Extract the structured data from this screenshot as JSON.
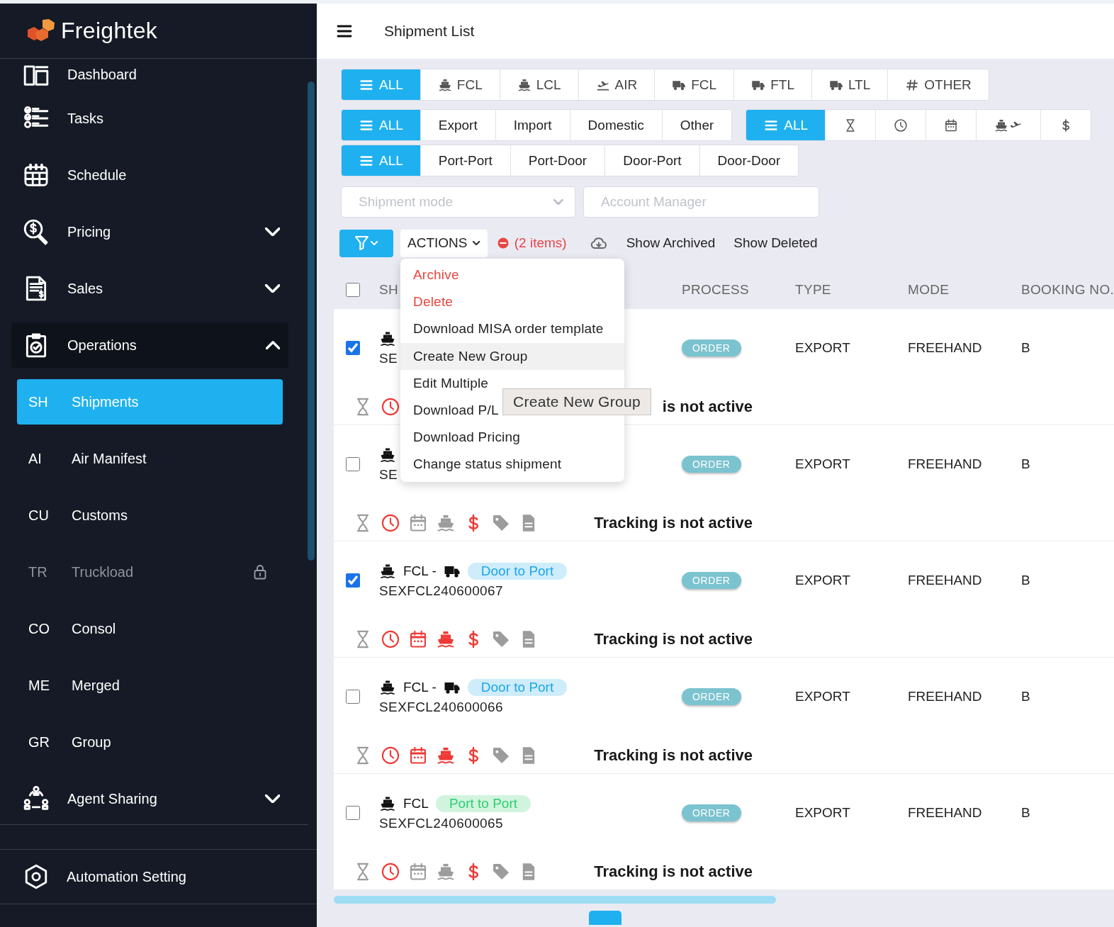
{
  "brand": {
    "name": "Freightek"
  },
  "sidebar": {
    "items": [
      {
        "kind": "main",
        "label": "Dashboard"
      },
      {
        "kind": "main",
        "label": "Tasks"
      },
      {
        "kind": "main",
        "label": "Schedule"
      },
      {
        "kind": "group",
        "label": "Pricing",
        "expanded": false
      },
      {
        "kind": "group",
        "label": "Sales",
        "expanded": false
      },
      {
        "kind": "group",
        "label": "Operations",
        "expanded": true
      },
      {
        "kind": "sub",
        "abbr": "SH",
        "label": "Shipments",
        "selected": true,
        "disabled": false
      },
      {
        "kind": "sub",
        "abbr": "AI",
        "label": "Air Manifest",
        "selected": false,
        "disabled": false
      },
      {
        "kind": "sub",
        "abbr": "CU",
        "label": "Customs",
        "selected": false,
        "disabled": false
      },
      {
        "kind": "sub",
        "abbr": "TR",
        "label": "Truckload",
        "selected": false,
        "disabled": true
      },
      {
        "kind": "sub",
        "abbr": "CO",
        "label": "Consol",
        "selected": false,
        "disabled": false
      },
      {
        "kind": "sub",
        "abbr": "ME",
        "label": "Merged",
        "selected": false,
        "disabled": false
      },
      {
        "kind": "sub",
        "abbr": "GR",
        "label": "Group",
        "selected": false,
        "disabled": false
      },
      {
        "kind": "group",
        "label": "Agent Sharing",
        "expanded": false
      }
    ],
    "footer_items": [
      {
        "label": "Automation Setting"
      }
    ]
  },
  "header": {
    "title": "Shipment List"
  },
  "filter_rows": [
    {
      "groups": [
        {
          "items": [
            {
              "kind": "list",
              "label": "ALL",
              "selected": true
            },
            {
              "kind": "ship",
              "label": "FCL",
              "selected": false
            },
            {
              "kind": "ship",
              "label": "LCL",
              "selected": false
            },
            {
              "kind": "plane",
              "label": "AIR",
              "selected": false
            },
            {
              "kind": "truck",
              "label": "FCL",
              "selected": false
            },
            {
              "kind": "truck",
              "label": "FTL",
              "selected": false
            },
            {
              "kind": "truck",
              "label": "LTL",
              "selected": false
            },
            {
              "kind": "hash",
              "label": "OTHER",
              "selected": false
            }
          ]
        }
      ]
    },
    {
      "groups": [
        {
          "items": [
            {
              "kind": "list",
              "label": "ALL",
              "selected": true
            },
            {
              "kind": "text",
              "label": "Export",
              "selected": false
            },
            {
              "kind": "text",
              "label": "Import",
              "selected": false
            },
            {
              "kind": "text",
              "label": "Domestic",
              "selected": false
            },
            {
              "kind": "text",
              "label": "Other",
              "selected": false
            }
          ]
        },
        {
          "items": [
            {
              "kind": "list",
              "label": "ALL",
              "selected": true
            },
            {
              "kind": "hourglass",
              "selected": false
            },
            {
              "kind": "clock",
              "selected": false
            },
            {
              "kind": "calendar",
              "selected": false
            },
            {
              "kind": "shipplane",
              "selected": false
            },
            {
              "kind": "dollar",
              "selected": false
            }
          ]
        }
      ]
    },
    {
      "groups": [
        {
          "items": [
            {
              "kind": "list",
              "label": "ALL",
              "selected": true
            },
            {
              "kind": "text",
              "label": "Port-Port",
              "selected": false
            },
            {
              "kind": "text",
              "label": "Port-Door",
              "selected": false
            },
            {
              "kind": "text",
              "label": "Door-Port",
              "selected": false
            },
            {
              "kind": "text",
              "label": "Door-Door",
              "selected": false
            }
          ]
        }
      ]
    }
  ],
  "fields": [
    {
      "kind": "select",
      "placeholder": "Shipment mode"
    },
    {
      "kind": "text",
      "placeholder": "Account Manager"
    }
  ],
  "toolbar": {
    "actions": {
      "label": "ACTIONS",
      "expanded": true
    },
    "selection": "(2 items)",
    "links": [
      "Show Archived",
      "Show Deleted"
    ]
  },
  "menu": {
    "items": [
      {
        "label": "Archive",
        "kind": "danger",
        "hovered": false
      },
      {
        "label": "Delete",
        "kind": "danger",
        "hovered": false
      },
      {
        "label": "Download MISA order template",
        "kind": "normal",
        "hovered": false
      },
      {
        "label": "Create New Group",
        "kind": "normal",
        "hovered": true
      },
      {
        "label": "Edit Multiple",
        "kind": "normal",
        "hovered": false
      },
      {
        "label": "Download P/L",
        "kind": "normal",
        "hovered": false
      },
      {
        "label": "Download Pricing",
        "kind": "normal",
        "hovered": false
      },
      {
        "label": "Change status shipment",
        "kind": "normal",
        "hovered": false
      }
    ],
    "tooltip": "Create New Group"
  },
  "table": {
    "all_checked": false,
    "columns": [
      "SH",
      "PROCESS",
      "TYPE",
      "MODE",
      "BOOKING NO."
    ],
    "rows": [
      {
        "checked": true,
        "code": "SE",
        "process": "ORDER",
        "type": "EXPORT",
        "mode": "FREEHAND",
        "booking": "B",
        "tracking": "is not active",
        "status_icons": [
          {
            "kind": "hourglass",
            "alert": false
          },
          {
            "kind": "clock",
            "alert": true
          }
        ]
      },
      {
        "checked": false,
        "code": "SE",
        "process": "ORDER",
        "type": "EXPORT",
        "mode": "FREEHAND",
        "booking": "B",
        "tracking": "Tracking is not active",
        "status_icons": [
          {
            "kind": "hourglass",
            "alert": false
          },
          {
            "kind": "clock",
            "alert": true
          },
          {
            "kind": "calendar",
            "alert": false
          },
          {
            "kind": "ship",
            "alert": false
          },
          {
            "kind": "dollar",
            "alert": true
          },
          {
            "kind": "tag",
            "alert": false
          },
          {
            "kind": "doc",
            "alert": false
          }
        ]
      },
      {
        "checked": true,
        "route": {
          "text": "FCL -",
          "truck": true
        },
        "service": {
          "label": "Door to Port",
          "color": "#1ea7e8"
        },
        "code": "SEXFCL240600067",
        "process": "ORDER",
        "type": "EXPORT",
        "mode": "FREEHAND",
        "booking": "B",
        "tracking": "Tracking is not active",
        "status_icons": [
          {
            "kind": "hourglass",
            "alert": false
          },
          {
            "kind": "clock",
            "alert": true
          },
          {
            "kind": "calendar",
            "alert": true
          },
          {
            "kind": "ship",
            "alert": true
          },
          {
            "kind": "dollar",
            "alert": true
          },
          {
            "kind": "tag",
            "alert": false
          },
          {
            "kind": "doc",
            "alert": false
          }
        ]
      },
      {
        "checked": false,
        "route": {
          "text": "FCL -",
          "truck": true
        },
        "service": {
          "label": "Door to Port",
          "color": "#1ea7e8"
        },
        "code": "SEXFCL240600066",
        "process": "ORDER",
        "type": "EXPORT",
        "mode": "FREEHAND",
        "booking": "B",
        "tracking": "Tracking is not active",
        "status_icons": [
          {
            "kind": "hourglass",
            "alert": false
          },
          {
            "kind": "clock",
            "alert": true
          },
          {
            "kind": "calendar",
            "alert": true
          },
          {
            "kind": "ship",
            "alert": true
          },
          {
            "kind": "dollar",
            "alert": true
          },
          {
            "kind": "tag",
            "alert": false
          },
          {
            "kind": "doc",
            "alert": false
          }
        ]
      },
      {
        "checked": false,
        "route": {
          "text": "FCL",
          "truck": false
        },
        "service": {
          "label": "Port to Port",
          "color": "#2fcf6f"
        },
        "code": "SEXFCL240600065",
        "process": "ORDER",
        "type": "EXPORT",
        "mode": "FREEHAND",
        "booking": "B",
        "tracking": "Tracking is not active",
        "status_icons": [
          {
            "kind": "hourglass",
            "alert": false
          },
          {
            "kind": "clock",
            "alert": true
          },
          {
            "kind": "calendar",
            "alert": false
          },
          {
            "kind": "ship",
            "alert": false
          },
          {
            "kind": "dollar",
            "alert": true
          },
          {
            "kind": "tag",
            "alert": false
          },
          {
            "kind": "doc",
            "alert": false
          }
        ]
      }
    ]
  }
}
